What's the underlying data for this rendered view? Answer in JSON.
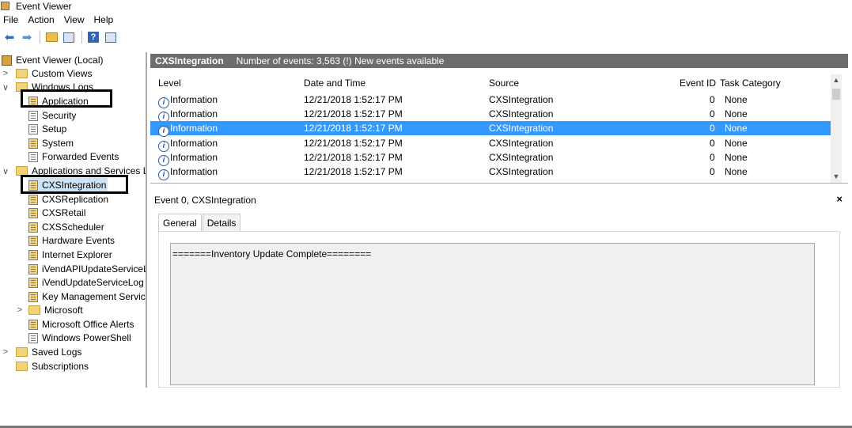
{
  "window": {
    "title": "Event Viewer"
  },
  "menu": [
    "File",
    "Action",
    "View",
    "Help"
  ],
  "toolbar": {
    "buttons": [
      "back-arrow-icon",
      "forward-arrow-icon",
      "up-folder-icon",
      "show-hide-tree-icon",
      "help-icon",
      "action-pane-icon"
    ]
  },
  "tree": {
    "root": "Event Viewer (Local)",
    "custom_views": "Custom Views",
    "windows_logs": "Windows Logs",
    "windows_logs_items": [
      "Application",
      "Security",
      "Setup",
      "System",
      "Forwarded Events"
    ],
    "app_services": "Applications and Services Lo",
    "app_services_items": [
      "CXSIntegration",
      "CXSReplication",
      "CXSRetail",
      "CXSScheduler",
      "Hardware Events",
      "Internet Explorer",
      "iVendAPIUpdateServiceLo",
      "iVendUpdateServiceLog",
      "Key Management Service",
      "Microsoft",
      "Microsoft Office Alerts",
      "Windows PowerShell"
    ],
    "saved_logs": "Saved Logs",
    "subscriptions": "Subscriptions"
  },
  "log_header": {
    "name": "CXSIntegration",
    "info": "Number of events: 3,563 (!) New events available"
  },
  "events": {
    "columns": [
      "Level",
      "Date and Time",
      "Source",
      "Event ID",
      "Task Category"
    ],
    "rows": [
      {
        "level": "Information",
        "datetime": "12/21/2018 1:52:17 PM",
        "source": "CXSIntegration",
        "event_id": "0",
        "category": "None"
      },
      {
        "level": "Information",
        "datetime": "12/21/2018 1:52:17 PM",
        "source": "CXSIntegration",
        "event_id": "0",
        "category": "None"
      },
      {
        "level": "Information",
        "datetime": "12/21/2018 1:52:17 PM",
        "source": "CXSIntegration",
        "event_id": "0",
        "category": "None"
      },
      {
        "level": "Information",
        "datetime": "12/21/2018 1:52:17 PM",
        "source": "CXSIntegration",
        "event_id": "0",
        "category": "None"
      },
      {
        "level": "Information",
        "datetime": "12/21/2018 1:52:17 PM",
        "source": "CXSIntegration",
        "event_id": "0",
        "category": "None"
      },
      {
        "level": "Information",
        "datetime": "12/21/2018 1:52:17 PM",
        "source": "CXSIntegration",
        "event_id": "0",
        "category": "None"
      }
    ],
    "selected_index": 2
  },
  "detail": {
    "title": "Event 0, CXSIntegration",
    "close": "×",
    "tabs": [
      "General",
      "Details"
    ],
    "description": "=======Inventory Update Complete========"
  },
  "colors": {
    "selection": "#3399ff",
    "header_bar": "#6d6d6d"
  }
}
